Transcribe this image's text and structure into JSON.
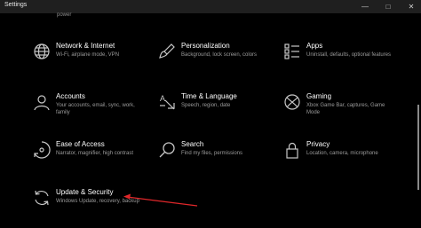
{
  "window": {
    "title": "Settings",
    "controls": {
      "minimize": "—",
      "maximize": "□",
      "close": "✕"
    }
  },
  "partial_top_rows": [
    "power",
    "",
    ""
  ],
  "tiles": [
    {
      "name": "Network & Internet",
      "desc": "Wi-Fi, airplane mode, VPN",
      "icon": "globe-icon"
    },
    {
      "name": "Personalization",
      "desc": "Background, lock screen, colors",
      "icon": "paintbrush-icon"
    },
    {
      "name": "Apps",
      "desc": "Uninstall, defaults, optional features",
      "icon": "apps-list-icon"
    },
    {
      "name": "Accounts",
      "desc": "Your accounts, email, sync, work, family",
      "icon": "person-icon"
    },
    {
      "name": "Time & Language",
      "desc": "Speech, region, date",
      "icon": "time-language-icon"
    },
    {
      "name": "Gaming",
      "desc": "Xbox Game Bar, captures, Game Mode",
      "icon": "xbox-icon"
    },
    {
      "name": "Ease of Access",
      "desc": "Narrator, magnifier, high contrast",
      "icon": "ease-of-access-icon"
    },
    {
      "name": "Search",
      "desc": "Find my files, permissions",
      "icon": "search-icon"
    },
    {
      "name": "Privacy",
      "desc": "Location, camera, microphone",
      "icon": "lock-icon"
    },
    {
      "name": "Update & Security",
      "desc": "Windows Update, recovery, backup",
      "icon": "update-sync-icon"
    }
  ],
  "annotation": {
    "color": "#e0272a",
    "points_to": "Update & Security"
  }
}
